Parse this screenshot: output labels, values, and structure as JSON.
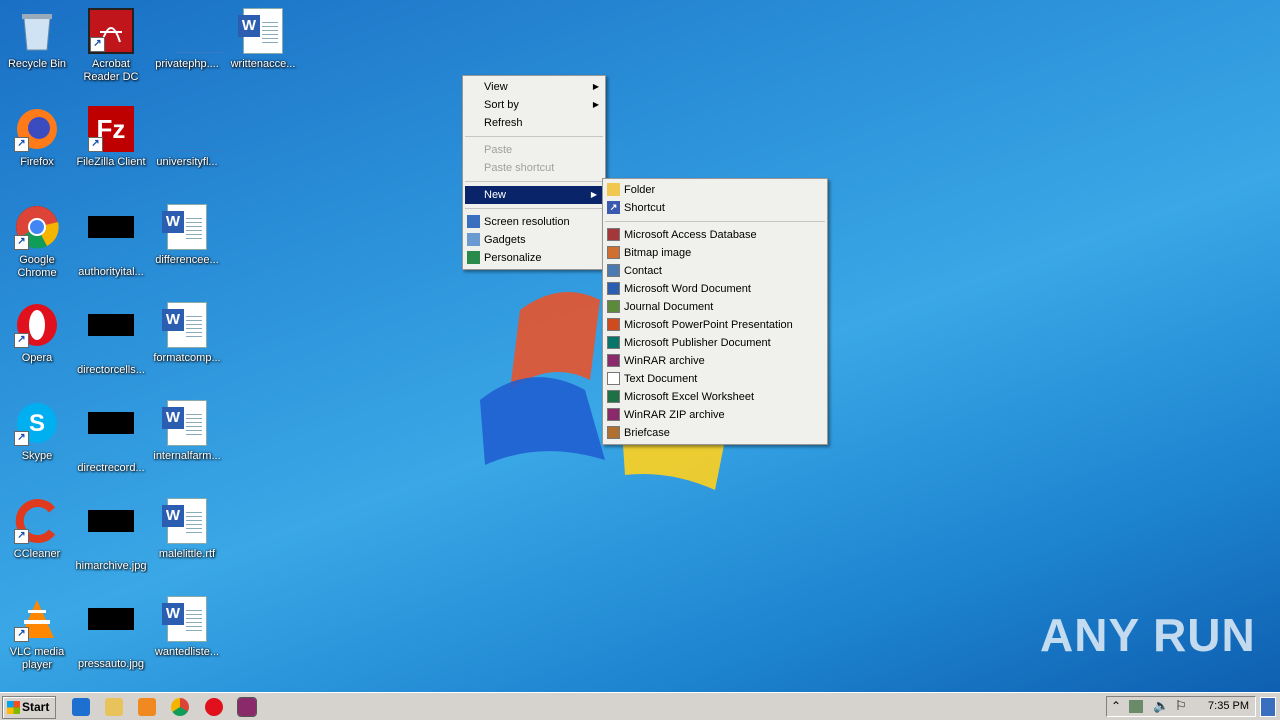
{
  "desktop_icons": [
    {
      "label": "Recycle Bin",
      "icon": "recycle-bin-icon"
    },
    {
      "label": "Acrobat Reader DC",
      "icon": "acrobat-icon"
    },
    {
      "label": "privatephp....",
      "icon": "blank-file-icon"
    },
    {
      "label": "writtenacce...",
      "icon": "word-doc-icon"
    },
    {
      "label": "Firefox",
      "icon": "firefox-icon"
    },
    {
      "label": "FileZilla Client",
      "icon": "filezilla-icon"
    },
    {
      "label": "universityfl...",
      "icon": "blank-file-icon"
    },
    {
      "label": "Google Chrome",
      "icon": "chrome-icon"
    },
    {
      "label": "authorityital...",
      "icon": "image-file-icon"
    },
    {
      "label": "differencee...",
      "icon": "word-doc-icon"
    },
    {
      "label": "Opera",
      "icon": "opera-icon"
    },
    {
      "label": "directorcells...",
      "icon": "image-file-icon"
    },
    {
      "label": "formatcomp...",
      "icon": "word-doc-icon"
    },
    {
      "label": "Skype",
      "icon": "skype-icon"
    },
    {
      "label": "directrecord...",
      "icon": "image-file-icon"
    },
    {
      "label": "internalfarm...",
      "icon": "word-doc-icon"
    },
    {
      "label": "CCleaner",
      "icon": "ccleaner-icon"
    },
    {
      "label": "himarchive.jpg",
      "icon": "image-file-icon"
    },
    {
      "label": "malelittle.rtf",
      "icon": "word-doc-icon"
    },
    {
      "label": "VLC media player",
      "icon": "vlc-icon"
    },
    {
      "label": "pressauto.jpg",
      "icon": "image-file-icon"
    },
    {
      "label": "wantedliste...",
      "icon": "word-doc-icon"
    }
  ],
  "context_menu": {
    "view": "View",
    "sort_by": "Sort by",
    "refresh": "Refresh",
    "paste": "Paste",
    "paste_shortcut": "Paste shortcut",
    "new": "New",
    "screen_resolution": "Screen resolution",
    "gadgets": "Gadgets",
    "personalize": "Personalize"
  },
  "new_submenu": {
    "folder": "Folder",
    "shortcut": "Shortcut",
    "items": [
      {
        "label": "Microsoft Access Database",
        "icon": "access-icon",
        "color": "#a4373a"
      },
      {
        "label": "Bitmap image",
        "icon": "paint-icon",
        "color": "#d07030"
      },
      {
        "label": "Contact",
        "icon": "contact-icon",
        "color": "#4a7ab0"
      },
      {
        "label": "Microsoft Word Document",
        "icon": "word-icon",
        "color": "#2b5eb0"
      },
      {
        "label": "Journal Document",
        "icon": "journal-icon",
        "color": "#5a8a3a"
      },
      {
        "label": "Microsoft PowerPoint Presentation",
        "icon": "powerpoint-icon",
        "color": "#d04a20"
      },
      {
        "label": "Microsoft Publisher Document",
        "icon": "publisher-icon",
        "color": "#077568"
      },
      {
        "label": "WinRAR archive",
        "icon": "winrar-icon",
        "color": "#8a2a6a"
      },
      {
        "label": "Text Document",
        "icon": "text-doc-icon",
        "color": "#ffffff"
      },
      {
        "label": "Microsoft Excel Worksheet",
        "icon": "excel-icon",
        "color": "#1e7145"
      },
      {
        "label": "WinRAR ZIP archive",
        "icon": "winrar-zip-icon",
        "color": "#8a2a6a"
      },
      {
        "label": "Briefcase",
        "icon": "briefcase-icon",
        "color": "#b07030"
      }
    ]
  },
  "taskbar": {
    "start": "Start",
    "clock": "7:35 PM",
    "pinned": [
      "ie-icon",
      "explorer-icon",
      "media-player-icon",
      "chrome-icon",
      "opera-icon",
      "winrar-icon"
    ]
  },
  "watermark": "ANY RUN"
}
